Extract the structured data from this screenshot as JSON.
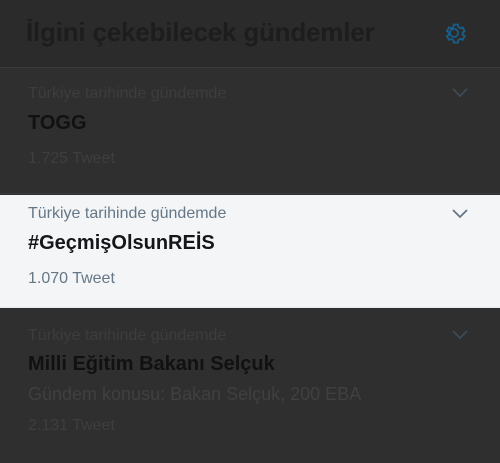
{
  "header": {
    "title": "İlgini çekebilecek gündemler",
    "settings_icon": "gear-icon"
  },
  "colors": {
    "dimmed_background": "#2f2f2f",
    "highlight_background": "#f4f5f7",
    "accent": "#1da1f2"
  },
  "trends": [
    {
      "context": "Türkiye tarihinde gündemde",
      "name": "TOGG",
      "count": "1.725 Tweet",
      "menu_icon": "chevron-down-icon"
    },
    {
      "context": "Türkiye tarihinde gündemde",
      "name": "#GeçmişOlsunREİS",
      "count": "1.070 Tweet",
      "menu_icon": "chevron-down-icon"
    },
    {
      "context": "Türkiye tarihinde gündemde",
      "name": "Milli Eğitim Bakanı Selçuk",
      "description": "Gündem konusu: Bakan Selçuk, 200 EBA",
      "count": "2.131 Tweet",
      "menu_icon": "chevron-down-icon"
    }
  ]
}
